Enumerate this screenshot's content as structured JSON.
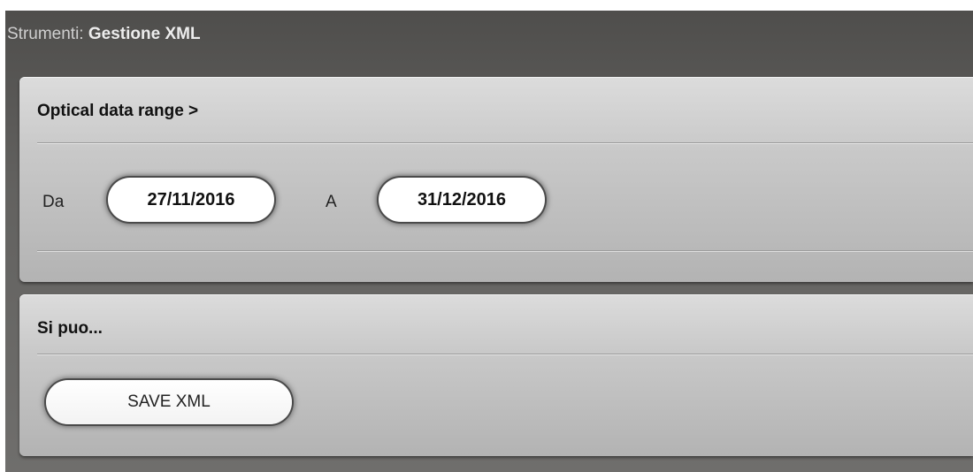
{
  "window": {
    "title_prefix": "Strumenti:",
    "title_main": "Gestione XML"
  },
  "date_range_panel": {
    "header": "Optical data range >",
    "from_label": "Da",
    "from_value": "27/11/2016",
    "to_label": "A",
    "to_value": "31/12/2016"
  },
  "actions_panel": {
    "header": "Si puo...",
    "save_button_label": "SAVE XML"
  },
  "colors": {
    "window_background": "#636260",
    "panel_background": "#c9c9c9",
    "pill_background": "#ffffff",
    "pill_border": "#4a4a4a"
  }
}
